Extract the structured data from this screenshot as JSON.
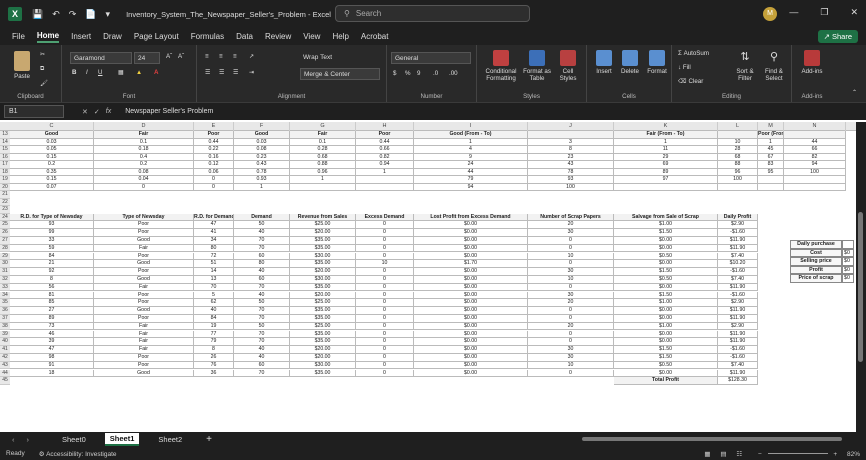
{
  "titlebar": {
    "title": "Inventory_System_The_Newspaper_Seller's_Problem - Excel",
    "search_placeholder": "Search",
    "avatar_initial": "M"
  },
  "menu": [
    "File",
    "Home",
    "Insert",
    "Draw",
    "Page Layout",
    "Formulas",
    "Data",
    "Review",
    "View",
    "Help",
    "Acrobat"
  ],
  "share_label": "Share",
  "ribbon": {
    "paste": "Paste",
    "clipboard": "Clipboard",
    "font_name": "Garamond",
    "font_size": "24",
    "font_group": "Font",
    "wrap_text": "Wrap Text",
    "merge_center": "Merge & Center",
    "alignment_group": "Alignment",
    "number_format": "General",
    "number_group": "Number",
    "conditional": "Conditional Formatting",
    "format_table": "Format as Table",
    "cell_styles": "Cell Styles",
    "styles_group": "Styles",
    "insert": "Insert",
    "delete": "Delete",
    "format": "Format",
    "cells_group": "Cells",
    "autosum": "AutoSum",
    "fill": "Fill",
    "clear": "Clear",
    "sort_filter": "Sort & Filter",
    "find_select": "Find & Select",
    "editing_group": "Editing",
    "addins": "Add-ins",
    "addins_group": "Add-ins"
  },
  "formula_bar": {
    "name_box": "B1",
    "content": "Newspaper Seller's Problem"
  },
  "columns": [
    "C",
    "D",
    "E",
    "F",
    "G",
    "H",
    "I",
    "J",
    "K",
    "L",
    "M",
    "N"
  ],
  "top_table": {
    "headers": [
      "Good",
      "Fair",
      "Poor",
      "Good",
      "Fair",
      "Poor",
      "Good (From - To)",
      "",
      "Fair (From - To)",
      "",
      "Poor (From - To)",
      ""
    ],
    "rows": [
      [
        "0.03",
        "0.1",
        "0.44",
        "0.03",
        "0.1",
        "0.44",
        "1",
        "3",
        "1",
        "10",
        "1",
        "44"
      ],
      [
        "0.05",
        "0.18",
        "0.22",
        "0.08",
        "0.28",
        "0.66",
        "4",
        "8",
        "11",
        "28",
        "45",
        "66"
      ],
      [
        "0.15",
        "0.4",
        "0.16",
        "0.23",
        "0.68",
        "0.82",
        "9",
        "23",
        "29",
        "68",
        "67",
        "82"
      ],
      [
        "0.2",
        "0.2",
        "0.12",
        "0.43",
        "0.88",
        "0.94",
        "24",
        "43",
        "69",
        "88",
        "83",
        "94"
      ],
      [
        "0.35",
        "0.08",
        "0.06",
        "0.78",
        "0.96",
        "1",
        "44",
        "78",
        "89",
        "96",
        "95",
        "100"
      ],
      [
        "0.15",
        "0.04",
        "0",
        "0.93",
        "1",
        "",
        "79",
        "93",
        "97",
        "100",
        "",
        ""
      ],
      [
        "0.07",
        "0",
        "0",
        "1",
        "",
        "",
        "94",
        "100",
        "",
        "",
        "",
        ""
      ]
    ]
  },
  "row_numbers_top": [
    "13",
    "14",
    "15",
    "16",
    "17",
    "18",
    "19",
    "20",
    "21",
    "22",
    "23"
  ],
  "sim_headers": [
    "R.D. for Type of Newsday",
    "Type of Newsday",
    "R.D. for Demand",
    "Demand",
    "Revenue from Sales",
    "Excess Demand",
    "Lost Profit from Excess Demand",
    "Number of Scrap Papers",
    "Salvage from Sale of Scrap",
    "Daily Profit"
  ],
  "sim_rows": [
    [
      "93",
      "Poor",
      "47",
      "50",
      "$25.00",
      "0",
      "$0.00",
      "20",
      "$1.00",
      "$2.90"
    ],
    [
      "99",
      "Poor",
      "41",
      "40",
      "$20.00",
      "0",
      "$0.00",
      "30",
      "$1.50",
      "-$1.60"
    ],
    [
      "33",
      "Good",
      "34",
      "70",
      "$35.00",
      "0",
      "$0.00",
      "0",
      "$0.00",
      "$11.90"
    ],
    [
      "59",
      "Fair",
      "80",
      "70",
      "$35.00",
      "0",
      "$0.00",
      "0",
      "$0.00",
      "$11.90"
    ],
    [
      "84",
      "Poor",
      "72",
      "60",
      "$30.00",
      "0",
      "$0.00",
      "10",
      "$0.50",
      "$7.40"
    ],
    [
      "21",
      "Good",
      "51",
      "80",
      "$35.00",
      "10",
      "$1.70",
      "0",
      "$0.00",
      "$10.20"
    ],
    [
      "92",
      "Poor",
      "14",
      "40",
      "$20.00",
      "0",
      "$0.00",
      "30",
      "$1.50",
      "-$1.60"
    ],
    [
      "8",
      "Good",
      "13",
      "60",
      "$30.00",
      "0",
      "$0.00",
      "10",
      "$0.50",
      "$7.40"
    ],
    [
      "56",
      "Fair",
      "70",
      "70",
      "$35.00",
      "0",
      "$0.00",
      "0",
      "$0.00",
      "$11.90"
    ],
    [
      "81",
      "Poor",
      "5",
      "40",
      "$20.00",
      "0",
      "$0.00",
      "30",
      "$1.50",
      "-$1.60"
    ],
    [
      "85",
      "Poor",
      "62",
      "50",
      "$25.00",
      "0",
      "$0.00",
      "20",
      "$1.00",
      "$2.90"
    ],
    [
      "27",
      "Good",
      "40",
      "70",
      "$35.00",
      "0",
      "$0.00",
      "0",
      "$0.00",
      "$11.90"
    ],
    [
      "89",
      "Poor",
      "84",
      "70",
      "$35.00",
      "0",
      "$0.00",
      "0",
      "$0.00",
      "$11.90"
    ],
    [
      "73",
      "Fair",
      "19",
      "50",
      "$25.00",
      "0",
      "$0.00",
      "20",
      "$1.00",
      "$2.90"
    ],
    [
      "46",
      "Fair",
      "77",
      "70",
      "$35.00",
      "0",
      "$0.00",
      "0",
      "$0.00",
      "$11.90"
    ],
    [
      "39",
      "Fair",
      "79",
      "70",
      "$35.00",
      "0",
      "$0.00",
      "0",
      "$0.00",
      "$11.90"
    ],
    [
      "47",
      "Fair",
      "8",
      "40",
      "$20.00",
      "0",
      "$0.00",
      "30",
      "$1.50",
      "-$1.60"
    ],
    [
      "98",
      "Poor",
      "26",
      "40",
      "$20.00",
      "0",
      "$0.00",
      "30",
      "$1.50",
      "-$1.60"
    ],
    [
      "91",
      "Poor",
      "76",
      "60",
      "$30.00",
      "0",
      "$0.00",
      "10",
      "$0.50",
      "$7.40"
    ],
    [
      "18",
      "Good",
      "36",
      "70",
      "$35.00",
      "0",
      "$0.00",
      "0",
      "$0.00",
      "$11.90"
    ]
  ],
  "total_label": "Total Profit",
  "total_value": "$128.30",
  "side_labels": [
    "Daily purchase",
    "Cost",
    "Selling price",
    "Profit",
    "Price of scrap"
  ],
  "side_values": [
    "",
    "$0",
    "$0",
    "$0",
    "$0"
  ],
  "sheets": [
    "Sheet0",
    "Sheet1",
    "Sheet2"
  ],
  "status": {
    "ready": "Ready",
    "accessibility": "Accessibility: Investigate",
    "zoom": "82%"
  }
}
